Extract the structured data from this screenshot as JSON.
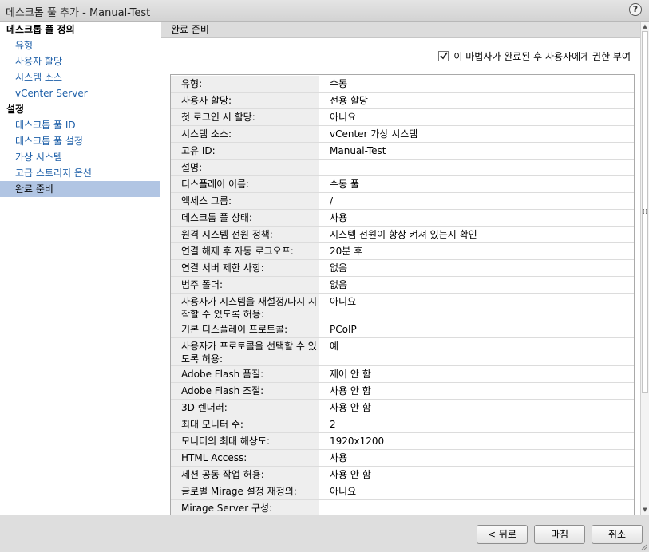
{
  "window": {
    "title": "데스크톱 풀 추가 - Manual-Test",
    "help_label": "?"
  },
  "sidebar": {
    "sections": [
      {
        "title": "데스크톱 풀 정의",
        "items": [
          "유형",
          "사용자 할당",
          "시스템 소스",
          "vCenter Server"
        ]
      },
      {
        "title": "설정",
        "items": [
          "데스크톱 풀 ID",
          "데스크톱 풀 설정",
          "가상 시스템",
          "고급 스토리지 옵션",
          "완료 준비"
        ]
      }
    ],
    "active_item": "완료 준비"
  },
  "main": {
    "header": "완료 준비",
    "entitle_checkbox": {
      "label": "이 마법사가 완료된 후 사용자에게 권한 부여",
      "checked": true
    },
    "summary_rows": [
      {
        "key": "유형:",
        "value": "수동"
      },
      {
        "key": "사용자 할당:",
        "value": "전용 할당"
      },
      {
        "key": "첫 로그인 시 할당:",
        "value": "아니요"
      },
      {
        "key": "시스템 소스:",
        "value": "vCenter 가상 시스템"
      },
      {
        "key": "고유 ID:",
        "value": "Manual-Test"
      },
      {
        "key": "설명:",
        "value": ""
      },
      {
        "key": "디스플레이 이름:",
        "value": "수동 풀"
      },
      {
        "key": "액세스 그룹:",
        "value": "/"
      },
      {
        "key": "데스크톱 풀 상태:",
        "value": "사용"
      },
      {
        "key": "원격 시스템 전원 정책:",
        "value": "시스템 전원이 항상 켜져 있는지 확인"
      },
      {
        "key": "연결 해제 후 자동 로그오프:",
        "value": "20분 후"
      },
      {
        "key": "연결 서버 제한 사항:",
        "value": "없음"
      },
      {
        "key": "범주 폴더:",
        "value": "없음"
      },
      {
        "key": "사용자가 시스템을 재설정/다시 시작할 수 있도록 허용:",
        "value": "아니요"
      },
      {
        "key": "기본 디스플레이 프로토콜:",
        "value": "PCoIP"
      },
      {
        "key": "사용자가 프로토콜을 선택할 수 있도록 허용:",
        "value": "예"
      },
      {
        "key": "Adobe Flash 품질:",
        "value": "제어 안 함"
      },
      {
        "key": "Adobe Flash 조절:",
        "value": "사용 안 함"
      },
      {
        "key": "3D 렌더러:",
        "value": "사용 안 함"
      },
      {
        "key": "최대 모니터 수:",
        "value": "2"
      },
      {
        "key": "모니터의 최대 해상도:",
        "value": "1920x1200"
      },
      {
        "key": "HTML Access:",
        "value": "사용"
      },
      {
        "key": "세션 공동 작업 허용:",
        "value": "사용 안 함"
      },
      {
        "key": "글로벌 Mirage 설정 재정의:",
        "value": "아니요"
      },
      {
        "key": "Mirage Server 구성:",
        "value": ""
      }
    ]
  },
  "footer": {
    "back_label": "< 뒤로",
    "finish_label": "마침",
    "cancel_label": "취소"
  }
}
